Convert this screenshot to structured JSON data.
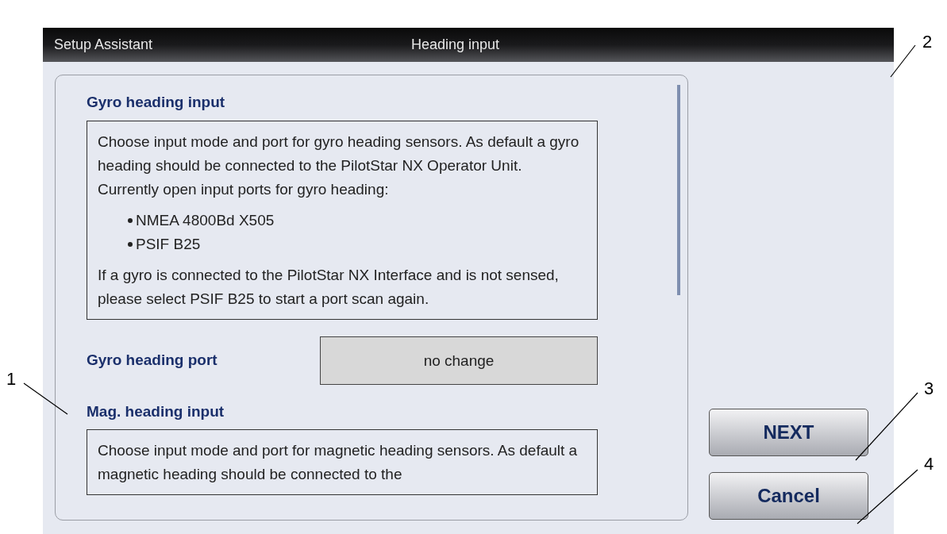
{
  "title_bar": {
    "left": "Setup Assistant",
    "center": "Heading input"
  },
  "sections": [
    {
      "kind": "info",
      "heading": "Gyro heading input",
      "paragraphs": [
        "Choose input mode and port for gyro heading sensors. As default a gyro heading should be connected to the PilotStar NX Operator Unit.",
        "Currently open input ports for gyro heading:"
      ],
      "bullets": [
        "NMEA 4800Bd X505",
        "PSIF B25"
      ],
      "note": "If a gyro is connected to the PilotStar NX Interface and is not sensed, please select PSIF B25 to start a port scan again."
    },
    {
      "kind": "field",
      "label": "Gyro heading port",
      "value": "no change"
    },
    {
      "kind": "info",
      "heading": "Mag. heading input",
      "paragraphs": [
        "Choose input mode and port for magnetic heading sensors. As default a magnetic heading should be connected to the"
      ]
    }
  ],
  "buttons": [
    "NEXT",
    "Cancel"
  ],
  "callouts": [
    "1",
    "2",
    "3",
    "4"
  ]
}
